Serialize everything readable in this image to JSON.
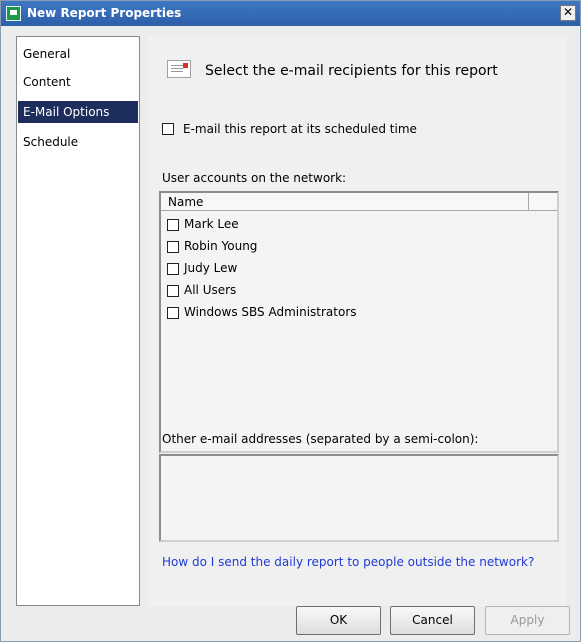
{
  "window": {
    "title": "New Report Properties",
    "close_glyph": "✕"
  },
  "nav": {
    "items": [
      {
        "label": "General",
        "selected": false
      },
      {
        "label": "Content",
        "selected": false
      },
      {
        "label": "E-Mail Options",
        "selected": true
      },
      {
        "label": "Schedule",
        "selected": false
      }
    ]
  },
  "content": {
    "heading": "Select the e-mail recipients for this report",
    "email_schedule_label": "E-mail this report at its scheduled time",
    "email_schedule_checked": false,
    "user_accounts_label": "User accounts on the network:",
    "list": {
      "column_name": "Name",
      "users": [
        {
          "name": "Mark Lee",
          "checked": false
        },
        {
          "name": "Robin Young",
          "checked": false
        },
        {
          "name": "Judy Lew",
          "checked": false
        },
        {
          "name": "All Users",
          "checked": false
        },
        {
          "name": "Windows SBS Administrators",
          "checked": false
        }
      ]
    },
    "other_addresses_label": "Other e-mail addresses (separated by a semi-colon):",
    "other_addresses_value": "",
    "help_link": "How do I send the daily report to people outside the network?"
  },
  "buttons": {
    "ok": "OK",
    "cancel": "Cancel",
    "apply": "Apply"
  },
  "colors": {
    "titlebar": "#2d5fa8",
    "nav_selected": "#1d2e5c",
    "link": "#1f3ad6"
  }
}
